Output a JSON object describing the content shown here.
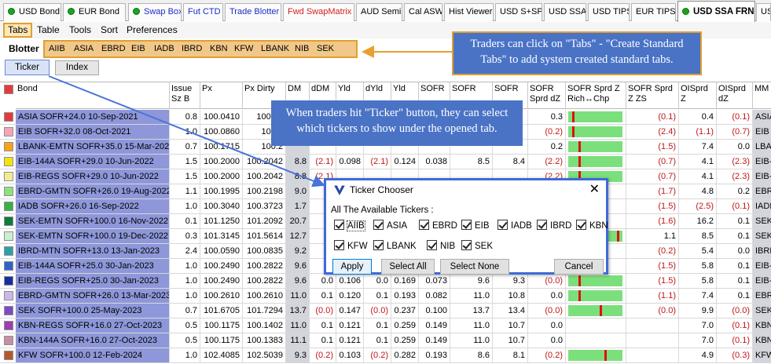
{
  "top_tabs": [
    {
      "label": "USD Bond",
      "dot": true,
      "color": "#000000"
    },
    {
      "label": "EUR Bond",
      "dot": true,
      "color": "#000000"
    },
    {
      "label": "Swap Box",
      "dot": true,
      "color": "#1a2ec8"
    },
    {
      "label": "Fut CTD",
      "dot": false,
      "color": "#1a2ec8"
    },
    {
      "label": "Trade Blotter",
      "dot": false,
      "color": "#1a2ec8"
    },
    {
      "label": "Fwd SwapMatrix",
      "dot": false,
      "color": "#d42020"
    },
    {
      "label": "AUD Semi",
      "dot": false,
      "color": "#000000"
    },
    {
      "label": "Cal ASW",
      "dot": false,
      "color": "#000000"
    },
    {
      "label": "Hist Viewer",
      "dot": false,
      "color": "#000000"
    },
    {
      "label": "USD S+SP",
      "dot": false,
      "color": "#000000"
    },
    {
      "label": "USD SSA",
      "dot": false,
      "color": "#000000"
    },
    {
      "label": "USD TIPS",
      "dot": false,
      "color": "#000000"
    },
    {
      "label": "EUR TIPS",
      "dot": false,
      "color": "#000000"
    },
    {
      "label": "USD SSA FRN",
      "dot": true,
      "color": "#000000",
      "active": true
    },
    {
      "label": "USD",
      "dot": false,
      "color": "#000000"
    }
  ],
  "menu": [
    "Tabs",
    "Table",
    "Tools",
    "Sort",
    "Preferences"
  ],
  "sub_tabs": [
    "Blotter",
    "AIIB",
    "ASIA",
    "EBRD",
    "EIB",
    "IADB",
    "IBRD",
    "KBN",
    "KFW",
    "LBANK",
    "NIB",
    "SEK"
  ],
  "mode_buttons": {
    "ticker": "Ticker",
    "index": "Index"
  },
  "columns": [
    {
      "key": "bond",
      "label": "Bond"
    },
    {
      "key": "issue",
      "label": "Issue Sz B"
    },
    {
      "key": "px",
      "label": "Px"
    },
    {
      "key": "pxd",
      "label": "Px Dirty"
    },
    {
      "key": "dm",
      "label": "DM"
    },
    {
      "key": "ddm",
      "label": "dDM"
    },
    {
      "key": "yld",
      "label": "Yld"
    },
    {
      "key": "dyld",
      "label": "dYld"
    },
    {
      "key": "yld2",
      "label": "Yld"
    },
    {
      "key": "sofr",
      "label": "SOFR"
    },
    {
      "key": "sofr2",
      "label": "SOFR"
    },
    {
      "key": "sofr3",
      "label": "SOFR"
    },
    {
      "key": "sofrdz",
      "label": "SOFR Sprd dZ"
    },
    {
      "key": "sofrz",
      "label": "SOFR Sprd Z Rich↔Chp"
    },
    {
      "key": "sofrzs",
      "label": "SOFR Sprd Z ZS"
    },
    {
      "key": "ois",
      "label": "OISprd Z"
    },
    {
      "key": "oisdz",
      "label": "OISprd dZ"
    },
    {
      "key": "mm",
      "label": "MM"
    }
  ],
  "rows": [
    {
      "swatch": "#e33b3b",
      "bond": "ASIA SOFR+24.0 10-Sep-2021",
      "issue": "0.8",
      "px": "100.0410",
      "pxd": "100.04",
      "dm": "",
      "ddm": "",
      "yld": "",
      "dyld": "",
      "yld2": "",
      "sofr": "",
      "sofr2": "",
      "sofr3": "",
      "sofrdz": "0.3",
      "mark": 0.08,
      "sofrzs": "(0.1)",
      "ois": "0.4",
      "oisdz": "(0.1)",
      "mm": "ASIA"
    },
    {
      "swatch": "#f3a6b5",
      "bond": "EIB SOFR+32.0 08-Oct-2021",
      "issue": "1.0",
      "px": "100.0860",
      "pxd": "100.1",
      "dm": "",
      "ddm": "",
      "yld": "",
      "dyld": "",
      "yld2": "",
      "sofr": "",
      "sofr2": "",
      "sofr3": "",
      "sofrdz": "(0.2)",
      "mark": 0.08,
      "sofrzs": "(2.4)",
      "ois": "(1.1)",
      "oisdz": "(0.7)",
      "mm": "EIB S"
    },
    {
      "swatch": "#f7a21b",
      "bond": "LBANK-EMTN SOFR+35.0 15-Mar-2022",
      "issue": "0.7",
      "px": "100.1715",
      "pxd": "100.2",
      "dm": "",
      "ddm": "",
      "yld": "",
      "dyld": "",
      "yld2": "",
      "sofr": "",
      "sofr2": "",
      "sofr3": "",
      "sofrdz": "0.2",
      "mark": 0.2,
      "sofrzs": "(1.5)",
      "ois": "7.4",
      "oisdz": "0.0",
      "mm": "LBAN"
    },
    {
      "swatch": "#f1e30d",
      "bond": "EIB-144A SOFR+29.0 10-Jun-2022",
      "issue": "1.5",
      "px": "100.2000",
      "pxd": "100.2042",
      "dm": "8.8",
      "ddm": "(2.1)",
      "yld": "0.098",
      "dyld": "(2.1)",
      "yld2": "0.124",
      "sofr": "0.038",
      "sofr2": "8.5",
      "sofr3": "8.4",
      "sofrdz": "(2.2)",
      "mark": 0.2,
      "sofrzs": "(0.7)",
      "ois": "4.1",
      "oisdz": "(2.3)",
      "mm": "EIB-1"
    },
    {
      "swatch": "#f3ea94",
      "bond": "EIB-REGS SOFR+29.0 10-Jun-2022",
      "issue": "1.5",
      "px": "100.2000",
      "pxd": "100.2042",
      "dm": "8.8",
      "ddm": "(2.1)",
      "yld": "",
      "dyld": "",
      "yld2": "",
      "sofr": "",
      "sofr2": "",
      "sofr3": "",
      "sofrdz": "(2.2)",
      "mark": 0.2,
      "sofrzs": "(0.7)",
      "ois": "4.1",
      "oisdz": "(2.3)",
      "mm": "EIB-F"
    },
    {
      "swatch": "#8fe07a",
      "bond": "EBRD-GMTN SOFR+26.0 19-Aug-2022",
      "issue": "1.1",
      "px": "100.1995",
      "pxd": "100.2198",
      "dm": "9.0",
      "ddm": "",
      "yld": "",
      "dyld": "",
      "yld2": "",
      "sofr": "",
      "sofr2": "",
      "sofr3": "",
      "sofrdz": "",
      "mark": null,
      "sofrzs": "(1.7)",
      "ois": "4.8",
      "oisdz": "0.2",
      "mm": "EBRI"
    },
    {
      "swatch": "#3cb043",
      "bond": "IADB SOFR+26.0 16-Sep-2022",
      "issue": "1.0",
      "px": "100.3040",
      "pxd": "100.3723",
      "dm": "1.7",
      "ddm": "",
      "yld": "",
      "dyld": "",
      "yld2": "",
      "sofr": "",
      "sofr2": "",
      "sofr3": "",
      "sofrdz": "",
      "mark": null,
      "sofrzs": "(1.5)",
      "ois": "(2.5)",
      "oisdz": "(0.1)",
      "mm": "IADE"
    },
    {
      "swatch": "#0e7c3a",
      "bond": "SEK-EMTN SOFR+100.0 16-Nov-2022",
      "issue": "0.1",
      "px": "101.1250",
      "pxd": "101.2092",
      "dm": "20.7",
      "ddm": "",
      "yld": "",
      "dyld": "",
      "yld2": "",
      "sofr": "",
      "sofr2": "",
      "sofr3": "",
      "sofrdz": "",
      "mark": null,
      "sofrzs": "(1.6)",
      "ois": "16.2",
      "oisdz": "0.1",
      "mm": "SEK-E"
    },
    {
      "swatch": "#c8f0d0",
      "bond": "SEK-EMTN SOFR+100.0 19-Dec-2022",
      "issue": "0.3",
      "px": "101.3145",
      "pxd": "101.5614",
      "dm": "12.7",
      "ddm": "",
      "yld": "",
      "dyld": "",
      "yld2": "",
      "sofr": "",
      "sofr2": "",
      "sofr3": "",
      "sofrdz": "",
      "mark": 0.95,
      "sofrzs": "1.1",
      "ois": "8.5",
      "oisdz": "0.1",
      "mm": "SEK-E"
    },
    {
      "swatch": "#2fa0a8",
      "bond": "IBRD-MTN SOFR+13.0 13-Jan-2023",
      "issue": "2.4",
      "px": "100.0590",
      "pxd": "100.0835",
      "dm": "9.2",
      "ddm": "",
      "yld": "",
      "dyld": "",
      "yld2": "",
      "sofr": "",
      "sofr2": "",
      "sofr3": "",
      "sofrdz": "",
      "mark": null,
      "sofrzs": "(0.2)",
      "ois": "5.4",
      "oisdz": "0.0",
      "mm": "IBRD"
    },
    {
      "swatch": "#2f63c9",
      "bond": "EIB-144A SOFR+25.0 30-Jan-2023",
      "issue": "1.0",
      "px": "100.2490",
      "pxd": "100.2822",
      "dm": "9.6",
      "ddm": "",
      "yld": "",
      "dyld": "",
      "yld2": "",
      "sofr": "",
      "sofr2": "",
      "sofr3": "",
      "sofrdz": "",
      "mark": null,
      "sofrzs": "(1.5)",
      "ois": "5.8",
      "oisdz": "0.1",
      "mm": "EIB-1"
    },
    {
      "swatch": "#1a2ea0",
      "bond": "EIB-REGS SOFR+25.0 30-Jan-2023",
      "issue": "1.0",
      "px": "100.2490",
      "pxd": "100.2822",
      "dm": "9.6",
      "ddm": "0.0",
      "yld": "0.106",
      "dyld": "0.0",
      "yld2": "0.169",
      "sofr": "0.073",
      "sofr2": "9.6",
      "sofr3": "9.3",
      "sofrdz": "(0.0)",
      "mark": 0.2,
      "sofrzs": "(1.5)",
      "ois": "5.8",
      "oisdz": "0.1",
      "mm": "EIB-F"
    },
    {
      "swatch": "#c9b8ec",
      "bond": "EBRD-GMTN SOFR+26.0 13-Mar-2023",
      "issue": "1.0",
      "px": "100.2610",
      "pxd": "100.2610",
      "dm": "11.0",
      "ddm": "0.1",
      "yld": "0.120",
      "dyld": "0.1",
      "yld2": "0.193",
      "sofr": "0.082",
      "sofr2": "11.0",
      "sofr3": "10.8",
      "sofrdz": "0.0",
      "mark": 0.2,
      "sofrzs": "(1.1)",
      "ois": "7.4",
      "oisdz": "0.1",
      "mm": "EBRI"
    },
    {
      "swatch": "#7b4bc4",
      "bond": "SEK SOFR+100.0 25-May-2023",
      "issue": "0.7",
      "px": "101.6705",
      "pxd": "101.7294",
      "dm": "13.7",
      "ddm": "(0.0)",
      "yld": "0.147",
      "dyld": "(0.0)",
      "yld2": "0.237",
      "sofr": "0.100",
      "sofr2": "13.7",
      "sofr3": "13.4",
      "sofrdz": "(0.0)",
      "mark": 0.62,
      "sofrzs": "(0.0)",
      "ois": "9.9",
      "oisdz": "(0.0)",
      "mm": "SEK-I"
    },
    {
      "swatch": "#9c3fb0",
      "bond": "KBN-REGS SOFR+16.0 27-Oct-2023",
      "issue": "0.5",
      "px": "100.1175",
      "pxd": "100.1402",
      "dm": "11.0",
      "ddm": "0.1",
      "yld": "0.121",
      "dyld": "0.1",
      "yld2": "0.259",
      "sofr": "0.149",
      "sofr2": "11.0",
      "sofr3": "10.7",
      "sofrdz": "0.0",
      "mark": null,
      "sofrzs": "",
      "ois": "7.0",
      "oisdz": "(0.1)",
      "mm": "KBN-F"
    },
    {
      "swatch": "#c78fa6",
      "bond": "KBN-144A SOFR+16.0 27-Oct-2023",
      "issue": "0.5",
      "px": "100.1175",
      "pxd": "100.1383",
      "dm": "11.1",
      "ddm": "0.1",
      "yld": "0.121",
      "dyld": "0.1",
      "yld2": "0.259",
      "sofr": "0.149",
      "sofr2": "11.0",
      "sofr3": "10.7",
      "sofrdz": "0.0",
      "mark": null,
      "sofrzs": "",
      "ois": "7.0",
      "oisdz": "(0.1)",
      "mm": "KBN-1"
    },
    {
      "swatch": "#b45a2a",
      "bond": "KFW SOFR+100.0 12-Feb-2024",
      "issue": "1.0",
      "px": "102.4085",
      "pxd": "102.5039",
      "dm": "9.3",
      "ddm": "(0.2)",
      "yld": "0.103",
      "dyld": "(0.2)",
      "yld2": "0.282",
      "sofr": "0.193",
      "sofr2": "8.6",
      "sofr3": "8.1",
      "sofrdz": "(0.2)",
      "mark": 0.7,
      "sofrzs": "",
      "ois": "4.9",
      "oisdz": "(0.3)",
      "mm": "KFW"
    }
  ],
  "callout_tabs": "Traders can click on \"Tabs\" - \"Create Standard Tabs\" to add system created standard tabs.",
  "callout_ticker": "When traders hit \"Ticker\" button, they can select which tickers to show under the opened tab.",
  "dialog": {
    "title": "Ticker Chooser",
    "close": "✕",
    "label": "All The Available Tickers :",
    "tickers": [
      "AIIB",
      "ASIA",
      "EBRD",
      "EIB",
      "IADB",
      "IBRD",
      "KBN",
      "KFW",
      "LBANK",
      "NIB",
      "SEK"
    ],
    "buttons": {
      "apply": "Apply",
      "select_all": "Select All",
      "select_none": "Select None",
      "cancel": "Cancel"
    }
  },
  "colors": {
    "accent_orange": "#e0a030",
    "callout_blue": "#4a73c6",
    "bond_col": "#8e97d9",
    "bar_green": "#7be07b",
    "bar_mark": "#e01010"
  }
}
